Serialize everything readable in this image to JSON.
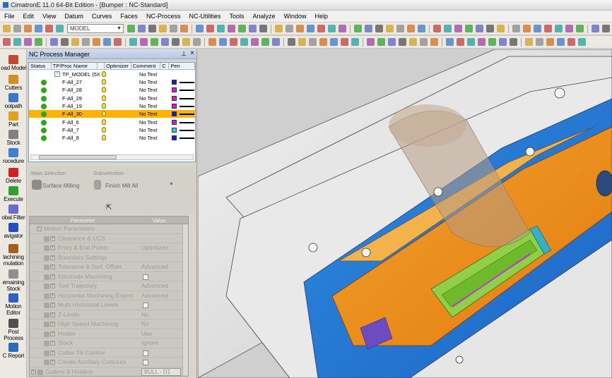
{
  "window": {
    "title": "CimatronE 11.0 64-Bit Edition - [Bumper : NC-Standard]"
  },
  "menu": [
    "File",
    "Edit",
    "View",
    "Datum",
    "Curves",
    "Faces",
    "NC-Process",
    "NC-Utilities",
    "Tools",
    "Analyze",
    "Window",
    "Help"
  ],
  "toolbar": {
    "mode_select": "MODEL"
  },
  "leftbar": [
    {
      "name": "load-model",
      "label": "oad Model",
      "icon_color": "#c04a2a"
    },
    {
      "name": "cutters",
      "label": "Cutters",
      "icon_color": "#d09020"
    },
    {
      "name": "toolpath",
      "label": "oolpath",
      "icon_color": "#3c78c8"
    },
    {
      "name": "part",
      "label": "Part",
      "icon_color": "#e0a020"
    },
    {
      "name": "stock",
      "label": "Stock",
      "icon_color": "#808080"
    },
    {
      "name": "procedure",
      "label": "rocedure",
      "icon_color": "#4080d0"
    },
    {
      "name": "delete",
      "label": "Delete",
      "icon_color": "#d02020"
    },
    {
      "name": "execute",
      "label": "Execute",
      "icon_color": "#30a030"
    },
    {
      "name": "global-filter",
      "label": "obal Filter",
      "icon_color": "#6a6ad0"
    },
    {
      "name": "navigator",
      "label": "avigator",
      "icon_color": "#2050c0"
    },
    {
      "name": "machining-simulation",
      "label": "lachining\nmulation",
      "icon_color": "#a06020"
    },
    {
      "name": "remaining-stock",
      "label": "emaining\nStock",
      "icon_color": "#909090"
    },
    {
      "name": "motion-editor",
      "label": "Motion\nEditor",
      "icon_color": "#3060c0"
    },
    {
      "name": "post-process",
      "label": "Post\nProcess",
      "icon_color": "#505050"
    },
    {
      "name": "nc-report",
      "label": "C Report",
      "icon_color": "#2a6db8"
    }
  ],
  "nc_manager": {
    "title": "NC Process Manager",
    "columns": [
      "Status",
      "TP/Proc Name",
      "",
      "Optimizer",
      "Comment",
      "C",
      "Pen"
    ],
    "root": {
      "name": "TP_MODEL (5X",
      "comment": "No Text"
    },
    "rows": [
      {
        "name": "F-All_27",
        "comment": "No Text",
        "color": "#1a1ad8",
        "selected": false
      },
      {
        "name": "F-All_28",
        "comment": "No Text",
        "color": "#d81ad8",
        "selected": false
      },
      {
        "name": "F-All_29",
        "comment": "No Text",
        "color": "#d81ad8",
        "selected": false
      },
      {
        "name": "F-All_19",
        "comment": "No Text",
        "color": "#d81ad8",
        "selected": false
      },
      {
        "name": "F-All_30",
        "comment": "No Text",
        "color": "#1a1ad8",
        "selected": true
      },
      {
        "name": "F-All_6",
        "comment": "No Text",
        "color": "#d81ad8",
        "selected": false
      },
      {
        "name": "F-All_7",
        "comment": "No Text",
        "color": "#18d8e0",
        "selected": false
      },
      {
        "name": "F-All_8",
        "comment": "No Text",
        "color": "#1a1ad8",
        "selected": false
      }
    ]
  },
  "selection": {
    "main_label": "Main Selection",
    "sub_label": "Subselection",
    "main_value": "Surface Milling",
    "sub_value": "Finish Mill All"
  },
  "params": {
    "columns": [
      "Parameter",
      "Value"
    ],
    "rows": [
      {
        "label": "Motion Parameters",
        "value": "",
        "kind": "group"
      },
      {
        "label": "Clearance & UCS",
        "value": "",
        "kind": "item"
      },
      {
        "label": "Entry & End Points",
        "value": "Optimized",
        "kind": "item"
      },
      {
        "label": "Boundary Settings",
        "value": "",
        "kind": "item"
      },
      {
        "label": "Tolerance & Surf. Offset",
        "value": "Advanced",
        "kind": "item"
      },
      {
        "label": "Electrode Machining",
        "value": "",
        "kind": "check"
      },
      {
        "label": "Tool Trajectory",
        "value": "Advanced",
        "kind": "item"
      },
      {
        "label": "Horizontal Machining Expert",
        "value": "Advanced",
        "kind": "item"
      },
      {
        "label": "Multi Horizontal Levels",
        "value": "",
        "kind": "check"
      },
      {
        "label": "Z-Limits",
        "value": "No",
        "kind": "item"
      },
      {
        "label": "High Speed Machining",
        "value": "No",
        "kind": "item"
      },
      {
        "label": "Holder",
        "value": "Use",
        "kind": "item"
      },
      {
        "label": "Stock",
        "value": "Ignore",
        "kind": "item"
      },
      {
        "label": "Cutter Tilt Control",
        "value": "",
        "kind": "check"
      },
      {
        "label": "Create Auxiliary Contours",
        "value": "",
        "kind": "check"
      },
      {
        "label": "Cutters & Holders",
        "value": "BULL - D1",
        "kind": "dropdown"
      }
    ]
  }
}
